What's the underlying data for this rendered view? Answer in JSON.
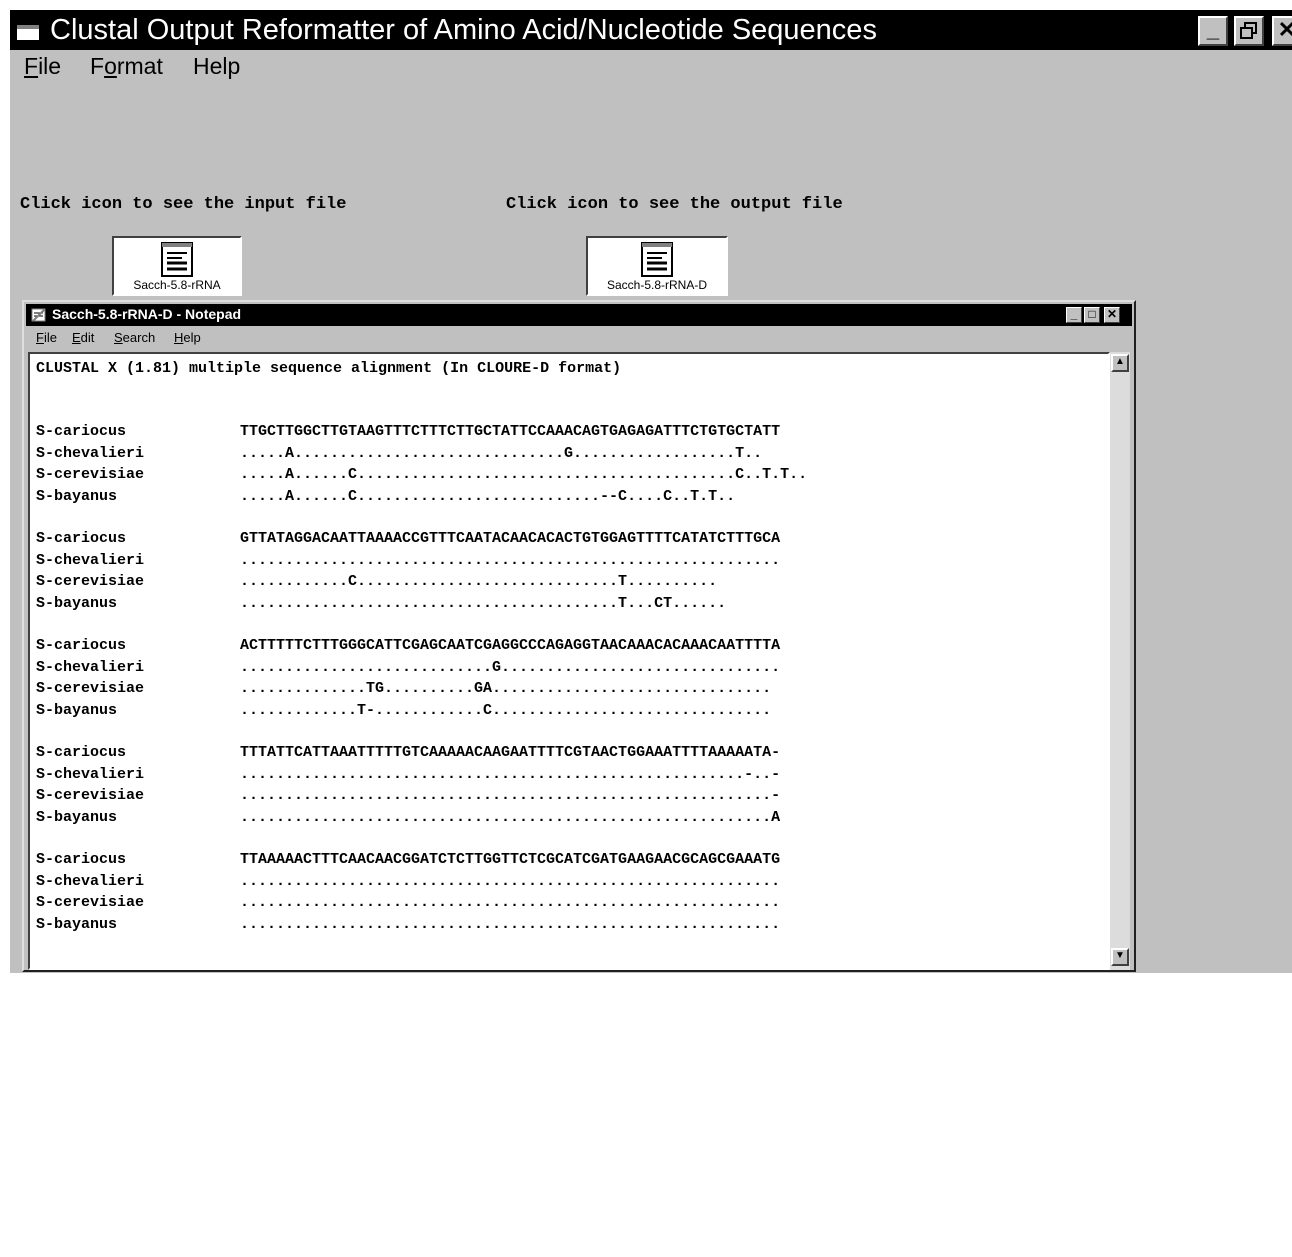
{
  "main_window": {
    "title": "Clustal Output Reformatter of Amino Acid/Nucleotide Sequences",
    "controls": {
      "minimize": "_",
      "restore": "🗗",
      "close": "✕"
    },
    "menu": [
      {
        "prefix": "",
        "accel": "F",
        "suffix": "ile"
      },
      {
        "prefix": "F",
        "accel": "o",
        "suffix": "rmat"
      },
      {
        "prefix": "Help",
        "accel": "",
        "suffix": ""
      }
    ],
    "input_label": "Click icon to see the input file",
    "output_label": "Click icon to see the output file",
    "input_icon_caption": "Sacch-5.8-rRNA",
    "output_icon_caption": "Sacch-5.8-rRNA-D"
  },
  "notepad": {
    "title": "Sacch-5.8-rRNA-D - Notepad",
    "menu": [
      {
        "accel": "F",
        "suffix": "ile"
      },
      {
        "accel": "E",
        "suffix": "dit"
      },
      {
        "accel": "S",
        "suffix": "earch"
      },
      {
        "accel": "H",
        "suffix": "elp"
      }
    ],
    "controls": {
      "minimize": "_",
      "maximize": "□",
      "close": "✕"
    },
    "header_line": "CLUSTAL X (1.81) multiple sequence alignment (In CLOURE-D format)",
    "blocks": [
      {
        "rows": [
          {
            "name": "S-cariocus",
            "seq": "TTGCTTGGCTTGTAAGTTTCTTTCTTGCTATTCCAAACAGTGAGAGATTTCTGTGCTATT"
          },
          {
            "name": "S-chevalieri",
            "seq": ".....A..............................G..................T.."
          },
          {
            "name": "S-cerevisiae",
            "seq": ".....A......C..........................................C..T.T.."
          },
          {
            "name": "S-bayanus",
            "seq": ".....A......C...........................--C....C..T.T.."
          }
        ]
      },
      {
        "rows": [
          {
            "name": "S-cariocus",
            "seq": "GTTATAGGACAATTAAAACCGTTTCAATACAACACACTGTGGAGTTTTCATATCTTTGCA"
          },
          {
            "name": "S-chevalieri",
            "seq": "............................................................"
          },
          {
            "name": "S-cerevisiae",
            "seq": "............C.............................T.........."
          },
          {
            "name": "S-bayanus",
            "seq": "..........................................T...CT......"
          }
        ]
      },
      {
        "rows": [
          {
            "name": "S-cariocus",
            "seq": "ACTTTTTCTTTGGGCATTCGAGCAATCGAGGCCCAGAGGTAACAAACACAAACAATTTTA"
          },
          {
            "name": "S-chevalieri",
            "seq": "............................G..............................."
          },
          {
            "name": "S-cerevisiae",
            "seq": "..............TG..........GA..............................."
          },
          {
            "name": "S-bayanus",
            "seq": ".............T-............C..............................."
          }
        ]
      },
      {
        "rows": [
          {
            "name": "S-cariocus",
            "seq": "TTTATTCATTAAATTTTTGTCAAAAACAAGAATTTTCGTAACTGGAAATTTTAAAAATA-"
          },
          {
            "name": "S-chevalieri",
            "seq": "........................................................-..-"
          },
          {
            "name": "S-cerevisiae",
            "seq": "...........................................................-"
          },
          {
            "name": "S-bayanus",
            "seq": "...........................................................A"
          }
        ]
      },
      {
        "rows": [
          {
            "name": "S-cariocus",
            "seq": "TTAAAAACTTTCAACAACGGATCTCTTGGTTCTCGCATCGATGAAGAACGCAGCGAAATG"
          },
          {
            "name": "S-chevalieri",
            "seq": "............................................................"
          },
          {
            "name": "S-cerevisiae",
            "seq": "............................................................"
          },
          {
            "name": "S-bayanus",
            "seq": "............................................................"
          }
        ]
      }
    ],
    "scroll_up": "▲",
    "scroll_down": "▼"
  }
}
